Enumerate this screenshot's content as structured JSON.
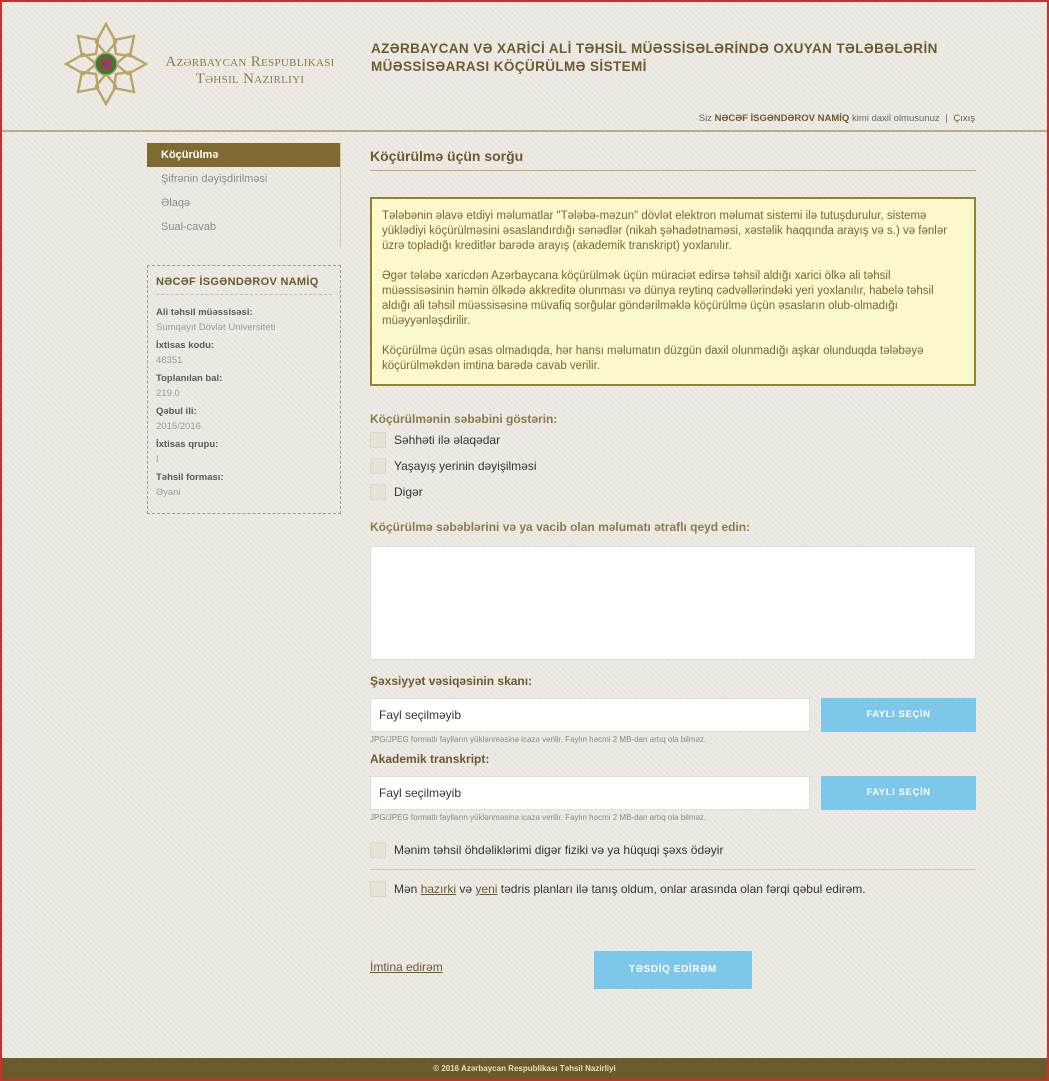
{
  "header": {
    "logo_text_line1": "Azərbaycan Respublikası",
    "logo_text_line2": "Təhsil Nazirliyi",
    "title_line1": "AZƏRBAYCAN VƏ XARİCİ ALİ TƏHSİL MÜƏSSİSƏLƏRİNDƏ OXUYAN TƏLƏBƏLƏRİN",
    "title_line2": "MÜƏSSİSƏARASI KÖÇÜRÜLMƏ SİSTEMİ",
    "user_prefix": "Siz",
    "user_name": "NƏCƏF İSGƏNDƏROV NAMİQ",
    "user_suffix": "kimi daxil olmusunuz",
    "separator": "|",
    "logout": "Çıxış"
  },
  "sidebar": {
    "nav": [
      {
        "label": "Köçürülmə",
        "active": true
      },
      {
        "label": "Şifrənin dəyişdirilməsi",
        "active": false
      },
      {
        "label": "Əlaqə",
        "active": false
      },
      {
        "label": "Sual-cavab",
        "active": false
      }
    ],
    "profile": {
      "name": "NƏCƏF İSGƏNDƏROV NAMİQ",
      "fields": [
        {
          "label": "Ali təhsil müəssisəsi:",
          "value": "Sumqayıt Dövlət Universiteti"
        },
        {
          "label": "İxtisas kodu:",
          "value": "48351"
        },
        {
          "label": "Toplanılan bal:",
          "value": "219.0"
        },
        {
          "label": "Qəbul ili:",
          "value": "2015/2016"
        },
        {
          "label": "İxtisas qrupu:",
          "value": "I"
        },
        {
          "label": "Təhsil forması:",
          "value": "Əyani"
        }
      ]
    }
  },
  "main": {
    "title": "Köçürülmə üçün sorğu",
    "notice": [
      "Tələbənin əlavə etdiyi məlumatlar \"Tələbə-məzun\" dövlət elektron məlumat sistemi ilə tutuşdurulur, sistemə yüklədiyi köçürülməsini əsaslandırdığı sənədlər (nikah şəhadətnaməsi, xəstəlik haqqında arayış və s.) və fənlər üzrə topladığı kreditlər barədə arayış (akademik transkript) yoxlanılır.",
      "Əgər tələbə xaricdən Azərbaycana köçürülmək üçün müraciət edirsə təhsil aldığı xarici ölkə ali təhsil müəssisəsinin həmin ölkədə akkreditə olunması və dünya reytinq cədvəllərindəki yeri yoxlanılır, habelə təhsil aldığı ali təhsil müəssisəsinə müvafiq sorğular göndərilməklə köçürülmə üçün əsasların olub-olmadığı müəyyənləşdirilir.",
      "Köçürülmə üçün əsas olmadıqda, hər hansı məlumatın düzgün daxil olunmadığı aşkar olunduqda tələbəyə köçürülməkdən imtina barədə cavab verilir."
    ],
    "reason_label": "Köçürülmənin səbəbini göstərin:",
    "reasons": [
      "Səhhəti ilə əlaqədar",
      "Yaşayış yerinin dəyişilməsi",
      "Digər"
    ],
    "details_label": "Köçürülmə səbəblərini və ya vacib olan məlumatı ətraflı qeyd edin:",
    "details_value": "",
    "id_scan": {
      "label": "Şəxsiyyət vəsiqəsinin skanı:",
      "value": "Fayl seçilməyib",
      "button": "FAYLI SEÇİN",
      "hint": "JPG/JPEG formatlı faylların yüklənməsinə icazə verilir. Faylın həcmi 2 MB-dan artıq ola bilməz."
    },
    "transcript": {
      "label": "Akademik transkript:",
      "value": "Fayl seçilməyib",
      "button": "FAYLI SEÇİN",
      "hint": "JPG/JPEG formatlı faylların yüklənməsinə icazə verilir. Faylın həcmi 2 MB-dan artıq ola bilməz."
    },
    "third_party_payment": "Mənim təhsil öhdəliklərimi digər fiziki və ya hüquqi şəxs ödəyir",
    "agreement": {
      "prefix": "Mən",
      "link1": "hazırki",
      "middle1": "və",
      "link2": "yeni",
      "suffix": "tədris planları ilə tanış oldum, onlar arasında olan fərqi qəbul edirəm."
    },
    "cancel": "İmtina edirəm",
    "confirm": "TƏSDİQ EDİRƏM"
  },
  "footer": {
    "text": "© 2016 Azərbaycan Respublikası Təhsil Nazirliyi"
  }
}
